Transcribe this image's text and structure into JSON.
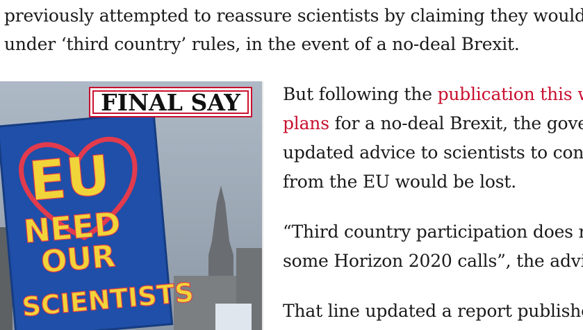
{
  "article": {
    "top_line_1": "previously attempted to reassure scientists by claiming they would",
    "top_line_2": "under ‘third country’ rules, in the event of a no-deal Brexit.",
    "image": {
      "badge_label": "FINAL SAY",
      "sign_lines": [
        "EU",
        "NEED",
        "OUR",
        "SCIENTISTS"
      ]
    },
    "paragraph_1": {
      "line_1_before": "But following the ",
      "line_1_link": "publication this w",
      "line_2_link": "plans",
      "line_2_after": " for a no-deal Brexit, the gove",
      "line_3": "updated advice to scientists to con",
      "line_4": "from the EU would be lost."
    },
    "paragraph_2": {
      "line_1": "“Third country participation does r",
      "line_2": "some Horizon 2020 calls”, the advi"
    },
    "paragraph_3": {
      "line_1": "That line updated a report publishe"
    }
  },
  "colors": {
    "link": "#c8102e",
    "text": "#1a1a1a",
    "badge_border": "#c8102e"
  }
}
